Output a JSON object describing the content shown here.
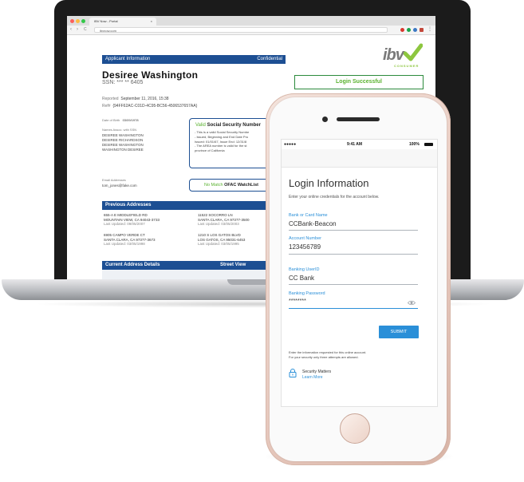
{
  "browser": {
    "tab_title": "IBV Now - Portal",
    "tab_close": "×",
    "nav_back": "‹",
    "nav_forward": "›",
    "nav_reload": "C",
    "url": "ibvnow.com"
  },
  "report": {
    "header_left": "Applicant Information",
    "header_right": "Confidential",
    "name": "Desiree  Washington",
    "ssn": "SSN: *** ** 6405",
    "reported_label": "Reported",
    "reported_value": "September 11, 2016, 15:38",
    "ref_label": "Ref#",
    "ref_value": "{94FF62AC-C01D-4C95-BC56-4506537657AA}",
    "dob_label": "Date of Birth",
    "dob_value": "03/09/1978",
    "names_label": "Names Assoc. with SSN",
    "names": [
      "DESIREE WASHINGTON",
      "DESIREE RICHARDSON",
      "DESIREE WASHINGTON",
      "WASHINGTON DESIREE"
    ],
    "email_label": "Email Addresses",
    "email_value": "tom_jones@fake.com",
    "login_status": "Login Successful",
    "ssn_box_valid": "Valid",
    "ssn_box_title": "Social Security Number",
    "ssn_box_lines": [
      "- This is a valid Social Security Numbe",
      "- Issued, Beginning and End Date Pro",
      "Issued: 01/01/67, Issue End: 12/31/8",
      "- The AREA number is valid for the st",
      "province of California"
    ],
    "ofac_status": "No Match",
    "ofac_label": "OFAC WatchList",
    "prev_header": "Previous Addresses",
    "prev_addresses": [
      {
        "line1": "655-A E MIDDLEFIELD RD",
        "line2": "MOUNTAIN VIEW, CA 94043-3733",
        "updated": "Last Updated: 09/05/2007"
      },
      {
        "line1": "11522 SOCORRO LN",
        "line2": "SANTA CLARA, CA 97377-3500",
        "updated": "Last Updated: 03/05/2003"
      },
      {
        "line1": "6905 CAMPO VERDE CT",
        "line2": "SANTA CLARA, CA 97377-3673",
        "updated": "Last Updated: 03/05/1998"
      },
      {
        "line1": "1210 S LOS GATOS BLVD",
        "line2": "LOS GATOS, CA 95031-6453",
        "updated": "Last Updated: 03/05/1995"
      }
    ],
    "current_header": "Current Address Details",
    "street_view": "Street View"
  },
  "logo": {
    "text": "ibv",
    "sub": "CONSUMER",
    "check_color": "#8dc63f"
  },
  "phone": {
    "carrier": "●●●●● ",
    "time": "9:41 AM",
    "battery": "100%",
    "title": "Login Information",
    "subtitle": "Enter your online credentials for the account below.",
    "fields": [
      {
        "label": "Bank or Card Name",
        "value": "CCBank-Beacon"
      },
      {
        "label": "Account Number",
        "value": "123456789"
      },
      {
        "label": "Banking UserID",
        "value": "CC Bank"
      },
      {
        "label": "Banking Password",
        "value": "********"
      }
    ],
    "submit_label": "SUBMIT",
    "info_line1": "Enter the information requested for this online account.",
    "info_line2": "For your security only three attempts are allowed.",
    "security_title": "Security Matters",
    "security_link": "Learn More"
  },
  "colors": {
    "accent_blue": "#2a8fd8",
    "report_blue": "#1d4f93",
    "success_green": "#5ab22f"
  }
}
